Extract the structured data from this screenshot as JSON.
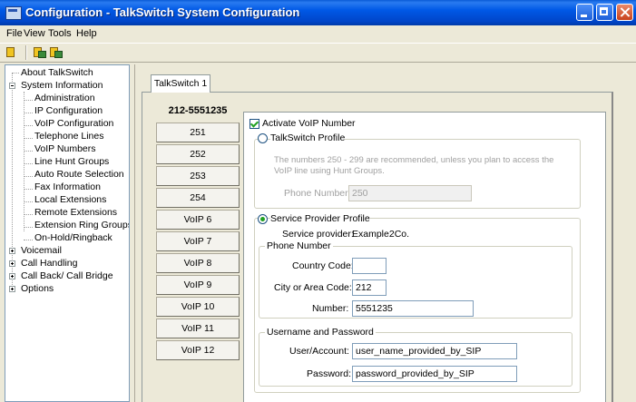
{
  "window": {
    "title": "Configuration - TalkSwitch System Configuration"
  },
  "menu": [
    "File",
    "View",
    "Tools",
    "Help"
  ],
  "tree": [
    {
      "label": "About TalkSwitch"
    },
    {
      "label": "System Information"
    },
    {
      "label": "Administration"
    },
    {
      "label": "IP Configuration"
    },
    {
      "label": "VoIP Configuration"
    },
    {
      "label": "Telephone Lines"
    },
    {
      "label": "VoIP Numbers"
    },
    {
      "label": "Line Hunt Groups"
    },
    {
      "label": "Auto Route Selection"
    },
    {
      "label": "Fax Information"
    },
    {
      "label": "Local Extensions"
    },
    {
      "label": "Remote Extensions"
    },
    {
      "label": "Extension Ring Groups"
    },
    {
      "label": "On-Hold/Ringback"
    },
    {
      "label": "Voicemail"
    },
    {
      "label": "Call Handling"
    },
    {
      "label": "Call Back/ Call Bridge"
    },
    {
      "label": "Options"
    }
  ],
  "tab": {
    "label": "TalkSwitch 1"
  },
  "phone_column": {
    "header": "212-5551235",
    "buttons": [
      "251",
      "252",
      "253",
      "254",
      "VoIP 6",
      "VoIP 7",
      "VoIP 8",
      "VoIP 9",
      "VoIP 10",
      "VoIP 11",
      "VoIP 12"
    ]
  },
  "voip": {
    "activate_label": "Activate VoIP Number",
    "activate_checked": true,
    "talkswitch_profile": {
      "label": "TalkSwitch Profile",
      "note": "The numbers 250 - 299 are recommended, unless you plan to access the VoIP line using Hunt Groups.",
      "phone_label": "Phone Number:",
      "phone_value": "250"
    },
    "service_provider": {
      "label": "Service Provider Profile",
      "provider_label": "Service provider:",
      "provider_value": "Example2Co.",
      "phone_group": "Phone Number",
      "country_label": "Country Code:",
      "country_value": "",
      "area_label": "City or Area Code:",
      "area_value": "212",
      "number_label": "Number:",
      "number_value": "5551235",
      "auth_group": "Username and Password",
      "user_label": "User/Account:",
      "user_value": "user_name_provided_by_SIP",
      "password_label": "Password:",
      "password_value": "password_provided_by_SIP"
    }
  }
}
